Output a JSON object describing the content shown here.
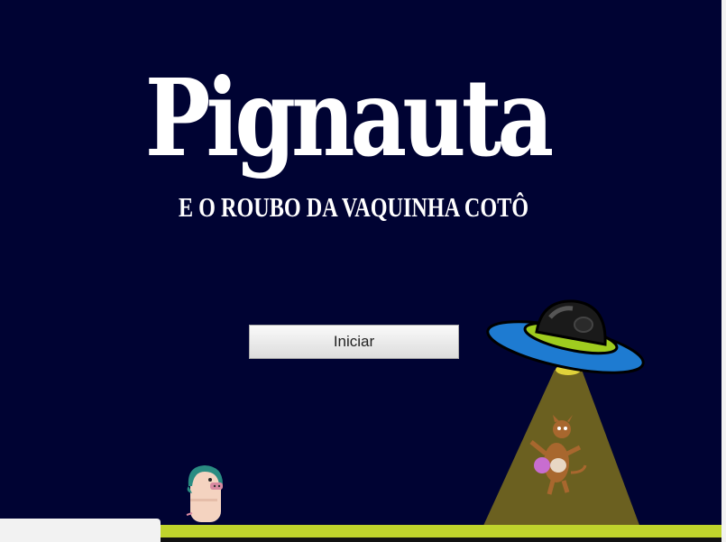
{
  "game": {
    "title": "Pignauta",
    "subtitle": "E O  ROUBO DA VAQUINHA COTÔ",
    "start_button_label": "Iniciar"
  },
  "colors": {
    "sky": "#000333",
    "ground": "#bfd32c",
    "beam": "#6b6020",
    "ufo_body": "#1e7bd1",
    "ufo_ring": "#9fcc1f"
  },
  "icons": [
    "pig-astronaut-icon",
    "ufo-icon",
    "tractor-beam",
    "cow-icon"
  ]
}
